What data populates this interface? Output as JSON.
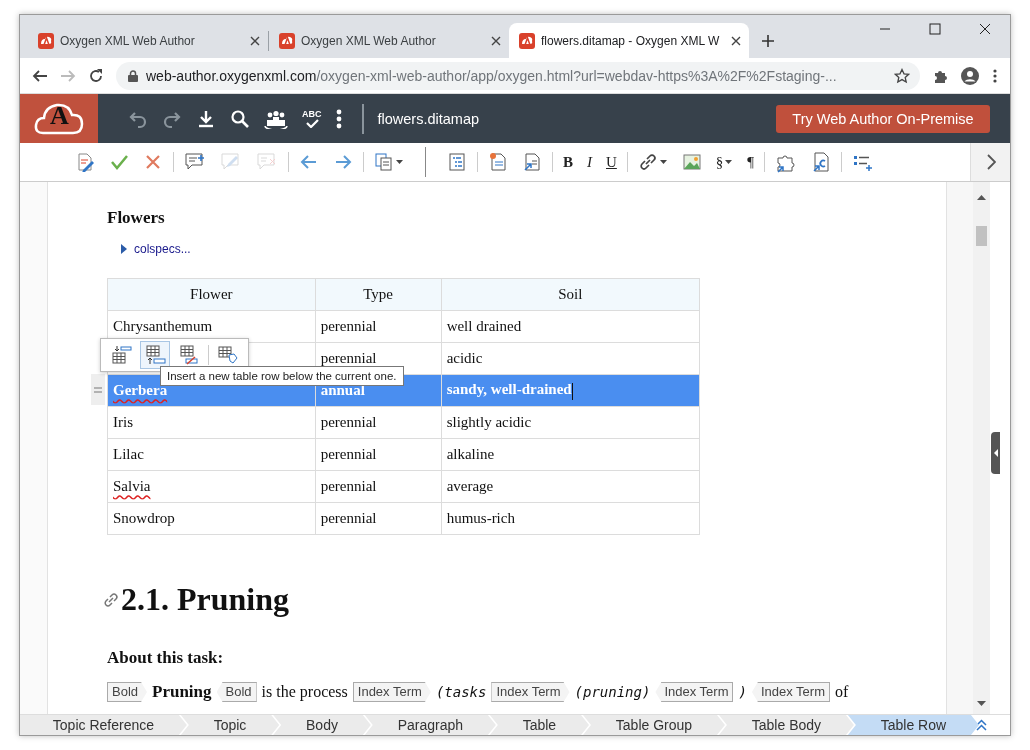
{
  "browser": {
    "tabs": [
      {
        "title": "Oxygen XML Web Author",
        "selected": false
      },
      {
        "title": "Oxygen XML Web Author",
        "selected": false
      },
      {
        "title": "flowers.ditamap - Oxygen XML W",
        "selected": true
      }
    ],
    "url_host": "web-author.oxygenxml.com",
    "url_path": "/oxygen-xml-web-author/app/oxygen.html?url=webdav-https%3A%2F%2Fstaging-..."
  },
  "app": {
    "logo_letter": "A",
    "spellcheck_label": "ABC",
    "document_name": "flowers.ditamap",
    "cta": "Try Web Author On-Premise"
  },
  "toolbar": [
    {
      "kind": "icon",
      "disabled": false,
      "dropdown": false
    },
    {
      "kind": "icon",
      "disabled": false,
      "dropdown": false
    },
    {
      "kind": "icon",
      "disabled": false,
      "dropdown": false
    },
    {
      "kind": "separator"
    },
    {
      "kind": "icon",
      "disabled": false,
      "dropdown": false
    },
    {
      "kind": "icon",
      "disabled": true,
      "dropdown": false
    },
    {
      "kind": "icon",
      "disabled": true,
      "dropdown": false
    },
    {
      "kind": "separator"
    },
    {
      "kind": "icon",
      "disabled": false,
      "dropdown": false
    },
    {
      "kind": "icon",
      "disabled": false,
      "dropdown": false
    },
    {
      "kind": "separator"
    },
    {
      "kind": "icon",
      "disabled": false,
      "dropdown": true
    },
    {
      "kind": "divider"
    },
    {
      "kind": "icon",
      "disabled": false,
      "dropdown": false
    },
    {
      "kind": "separator"
    },
    {
      "kind": "icon",
      "disabled": false,
      "dropdown": false
    },
    {
      "kind": "icon",
      "disabled": false,
      "dropdown": false
    },
    {
      "kind": "separator"
    },
    {
      "kind": "bold",
      "label": "B",
      "disabled": false,
      "dropdown": false
    },
    {
      "kind": "italic",
      "label": "I",
      "disabled": false,
      "dropdown": false
    },
    {
      "kind": "underline",
      "label": "U",
      "disabled": false,
      "dropdown": false
    },
    {
      "kind": "separator"
    },
    {
      "kind": "icon",
      "disabled": false,
      "dropdown": true
    },
    {
      "kind": "icon",
      "disabled": false,
      "dropdown": false
    },
    {
      "kind": "glyph",
      "label": "§",
      "disabled": false,
      "dropdown": true
    },
    {
      "kind": "glyph",
      "label": "¶",
      "disabled": false,
      "dropdown": false
    },
    {
      "kind": "separator"
    },
    {
      "kind": "icon",
      "disabled": false,
      "dropdown": false
    },
    {
      "kind": "icon",
      "disabled": false,
      "dropdown": false
    },
    {
      "kind": "separator"
    },
    {
      "kind": "icon",
      "disabled": false,
      "dropdown": false
    }
  ],
  "document": {
    "section_title": "Flowers",
    "colspecs": "colspecs...",
    "columns": [
      "Flower",
      "Type",
      "Soil"
    ],
    "rows": [
      {
        "flower": "Chrysanthemum",
        "type": "perennial",
        "soil": "well drained",
        "selected": false,
        "misspelled": false
      },
      {
        "type": "perennial",
        "soil": "acidic",
        "selected": false
      },
      {
        "flower": "Gerbera",
        "type": "annual",
        "soil": "sandy, well-drained",
        "selected": true,
        "misspelled": true
      },
      {
        "flower": "Iris",
        "type": "perennial",
        "soil": "slightly acidic",
        "selected": false,
        "misspelled": false
      },
      {
        "flower": "Lilac",
        "type": "perennial",
        "soil": "alkaline",
        "selected": false,
        "misspelled": false
      },
      {
        "flower": "Salvia",
        "type": "perennial",
        "soil": "average",
        "selected": false,
        "misspelled": true
      },
      {
        "flower": "Snowdrop",
        "type": "perennial",
        "soil": "humus-rich",
        "selected": false,
        "misspelled": false
      }
    ],
    "table_actions": [
      {
        "hovered": false
      },
      {
        "hovered": true
      },
      {
        "hovered": false
      },
      {
        "hovered": false
      }
    ],
    "tooltip": "Insert a new table row below the current one.",
    "heading": "2.1. Pruning",
    "task_label": "About this task:",
    "paragraph": [
      {
        "kind": "tag-start",
        "text": "Bold"
      },
      {
        "kind": "bold",
        "text": "Pruning"
      },
      {
        "kind": "tag-end",
        "text": "Bold"
      },
      {
        "kind": "text",
        "text": "is the process"
      },
      {
        "kind": "tag-start",
        "text": "Index Term"
      },
      {
        "kind": "code",
        "text": "(tasks"
      },
      {
        "kind": "tag-start",
        "text": "Index Term"
      },
      {
        "kind": "code",
        "text": "(pruning)"
      },
      {
        "kind": "tag-end",
        "text": "Index Term"
      },
      {
        "kind": "code",
        "text": ")"
      },
      {
        "kind": "tag-end",
        "text": "Index Term"
      },
      {
        "kind": "text",
        "text": "of"
      }
    ]
  },
  "breadcrumb": [
    {
      "label": "Topic Reference",
      "selected": false
    },
    {
      "label": "Topic",
      "selected": false
    },
    {
      "label": "Body",
      "selected": false
    },
    {
      "label": "Paragraph",
      "selected": false
    },
    {
      "label": "Table",
      "selected": false
    },
    {
      "label": "Table Group",
      "selected": false
    },
    {
      "label": "Table Body",
      "selected": false
    },
    {
      "label": "Table Row",
      "selected": true
    }
  ]
}
